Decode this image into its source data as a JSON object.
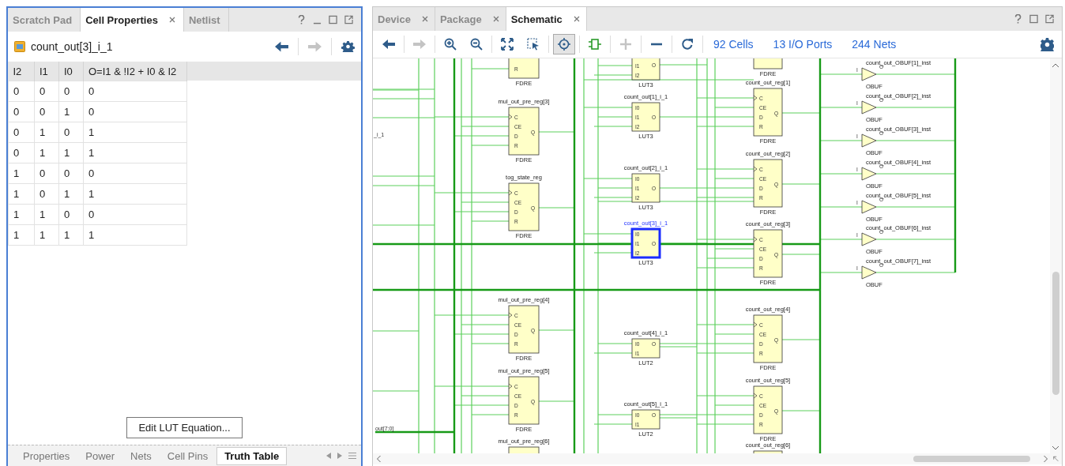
{
  "cell_properties_panel": {
    "tabs": [
      {
        "label": "Scratch Pad",
        "selected": false,
        "closable": false
      },
      {
        "label": "Cell Properties",
        "selected": true,
        "closable": true
      },
      {
        "label": "Netlist",
        "selected": false,
        "closable": false
      }
    ],
    "cell_name": "count_out[3]_i_1",
    "toolbar": [
      {
        "kind": "back",
        "disabled": false
      },
      {
        "kind": "forward",
        "disabled": true
      },
      {
        "kind": "settings",
        "disabled": false
      }
    ],
    "truth_table": {
      "columns": [
        "I2",
        "I1",
        "I0",
        "O=I1 & !I2 + I0 & I2"
      ],
      "rows": [
        [
          "0",
          "0",
          "0",
          "0"
        ],
        [
          "0",
          "0",
          "1",
          "0"
        ],
        [
          "0",
          "1",
          "0",
          "1"
        ],
        [
          "0",
          "1",
          "1",
          "1"
        ],
        [
          "1",
          "0",
          "0",
          "0"
        ],
        [
          "1",
          "0",
          "1",
          "1"
        ],
        [
          "1",
          "1",
          "0",
          "0"
        ],
        [
          "1",
          "1",
          "1",
          "1"
        ]
      ]
    },
    "edit_button": "Edit LUT Equation...",
    "bottom_tabs": [
      {
        "label": "Properties",
        "selected": false
      },
      {
        "label": "Power",
        "selected": false
      },
      {
        "label": "Nets",
        "selected": false
      },
      {
        "label": "Cell Pins",
        "selected": false
      },
      {
        "label": "Truth Table",
        "selected": true
      }
    ]
  },
  "schematic_panel": {
    "tabs": [
      {
        "label": "Device",
        "selected": false
      },
      {
        "label": "Package",
        "selected": false
      },
      {
        "label": "Schematic",
        "selected": true
      }
    ],
    "toolbar": [
      {
        "kind": "back",
        "disabled": false,
        "selected": false
      },
      {
        "kind": "forward",
        "disabled": true,
        "selected": false
      },
      {
        "kind": "zoom-in",
        "disabled": false,
        "selected": false
      },
      {
        "kind": "zoom-out",
        "disabled": false,
        "selected": false
      },
      {
        "kind": "fit",
        "disabled": false,
        "selected": false
      },
      {
        "kind": "select-area",
        "disabled": false,
        "selected": false
      },
      {
        "kind": "auto-fit",
        "disabled": false,
        "selected": true
      },
      {
        "kind": "module",
        "disabled": false,
        "selected": false
      },
      {
        "kind": "expand",
        "disabled": true,
        "selected": false
      },
      {
        "kind": "collapse",
        "disabled": false,
        "selected": false
      },
      {
        "kind": "refresh",
        "disabled": false,
        "selected": false
      }
    ],
    "stats": [
      "92 Cells",
      "13 I/O Ports",
      "244 Nets"
    ],
    "schematic": {
      "port_labels": [
        "_i_1",
        "out[7:0]"
      ],
      "cells": [
        {
          "kind": "ff",
          "type": "FDRE",
          "inputs": [
            "R"
          ],
          "selected": false
        },
        {
          "kind": "ff",
          "name": "mul_out_pre_reg[3]",
          "type": "FDRE",
          "inputs": [
            "C",
            "CE",
            "D",
            "R"
          ],
          "outputs": [
            "Q"
          ],
          "selected": false
        },
        {
          "kind": "ff",
          "name": "tog_state_reg",
          "type": "FDRE",
          "inputs": [
            "C",
            "CE",
            "D",
            "R"
          ],
          "outputs": [
            "Q"
          ],
          "selected": false
        },
        {
          "kind": "ff",
          "name": "mul_out_pre_reg[4]",
          "type": "FDRE",
          "inputs": [
            "C",
            "CE",
            "D",
            "R"
          ],
          "outputs": [
            "Q"
          ],
          "selected": false
        },
        {
          "kind": "ff",
          "name": "mul_out_pre_reg[5]",
          "type": "FDRE",
          "inputs": [
            "C",
            "CE",
            "D",
            "R"
          ],
          "outputs": [
            "Q"
          ],
          "selected": false
        },
        {
          "kind": "ff",
          "name": "mul_out_pre_reg[6]",
          "selected": false
        },
        {
          "kind": "lut",
          "type": "LUT3",
          "inputs": [
            "I1",
            "I2"
          ],
          "outputs": [
            "O"
          ],
          "selected": false
        },
        {
          "kind": "lut",
          "name": "count_out[1]_i_1",
          "type": "LUT3",
          "inputs": [
            "I0",
            "I1",
            "I2"
          ],
          "outputs": [
            "O"
          ],
          "selected": false
        },
        {
          "kind": "lut",
          "name": "count_out[2]_i_1",
          "type": "LUT3",
          "inputs": [
            "I0",
            "I1",
            "I2"
          ],
          "outputs": [
            "O"
          ],
          "selected": false
        },
        {
          "kind": "lut",
          "name": "count_out[3]_i_1",
          "type": "LUT3",
          "inputs": [
            "I0",
            "I1",
            "I2"
          ],
          "outputs": [
            "O"
          ],
          "selected": true
        },
        {
          "kind": "lut",
          "name": "count_out[4]_i_1",
          "type": "LUT2",
          "inputs": [
            "I0",
            "I1"
          ],
          "outputs": [
            "O"
          ],
          "selected": false
        },
        {
          "kind": "lut",
          "name": "count_out[5]_i_1",
          "type": "LUT2",
          "inputs": [
            "I0",
            "I1"
          ],
          "outputs": [
            "O"
          ],
          "selected": false
        },
        {
          "kind": "ff",
          "type": "FDRE",
          "selected": false
        },
        {
          "kind": "ff",
          "name": "count_out_reg[1]",
          "type": "FDRE",
          "inputs": [
            "C",
            "CE",
            "D",
            "R"
          ],
          "outputs": [
            "Q"
          ],
          "selected": false
        },
        {
          "kind": "ff",
          "name": "count_out_reg[2]",
          "type": "FDRE",
          "inputs": [
            "C",
            "CE",
            "D",
            "R"
          ],
          "outputs": [
            "Q"
          ],
          "selected": false
        },
        {
          "kind": "ff",
          "name": "count_out_reg[3]",
          "type": "FDRE",
          "inputs": [
            "C",
            "CE",
            "D",
            "R"
          ],
          "outputs": [
            "Q"
          ],
          "selected": false
        },
        {
          "kind": "ff",
          "name": "count_out_reg[4]",
          "type": "FDRE",
          "inputs": [
            "C",
            "CE",
            "D",
            "R"
          ],
          "outputs": [
            "Q"
          ],
          "selected": false
        },
        {
          "kind": "ff",
          "name": "count_out_reg[5]",
          "type": "FDRE",
          "inputs": [
            "C",
            "CE",
            "D",
            "R"
          ],
          "outputs": [
            "Q"
          ],
          "selected": false
        },
        {
          "kind": "ff",
          "name": "count_out_reg[6]",
          "selected": false
        },
        {
          "kind": "obuf",
          "name": "count_out_OBUF[1]_inst",
          "type": "OBUF",
          "inputs": [
            "I"
          ],
          "outputs": [
            "O"
          ],
          "selected": false
        },
        {
          "kind": "obuf",
          "name": "count_out_OBUF[2]_inst",
          "type": "OBUF",
          "inputs": [
            "I"
          ],
          "outputs": [
            "O"
          ],
          "selected": false
        },
        {
          "kind": "obuf",
          "name": "count_out_OBUF[3]_inst",
          "type": "OBUF",
          "inputs": [
            "I"
          ],
          "outputs": [
            "O"
          ],
          "selected": false
        },
        {
          "kind": "obuf",
          "name": "count_out_OBUF[4]_inst",
          "type": "OBUF",
          "inputs": [
            "I"
          ],
          "outputs": [
            "O"
          ],
          "selected": false
        },
        {
          "kind": "obuf",
          "name": "count_out_OBUF[5]_inst",
          "type": "OBUF",
          "inputs": [
            "I"
          ],
          "outputs": [
            "O"
          ],
          "selected": false
        },
        {
          "kind": "obuf",
          "name": "count_out_OBUF[6]_inst",
          "type": "OBUF",
          "inputs": [
            "I"
          ],
          "outputs": [
            "O"
          ],
          "selected": false
        },
        {
          "kind": "obuf",
          "name": "count_out_OBUF[7]_inst",
          "type": "OBUF",
          "inputs": [
            "I"
          ],
          "outputs": [
            "O"
          ],
          "selected": false
        }
      ]
    }
  }
}
